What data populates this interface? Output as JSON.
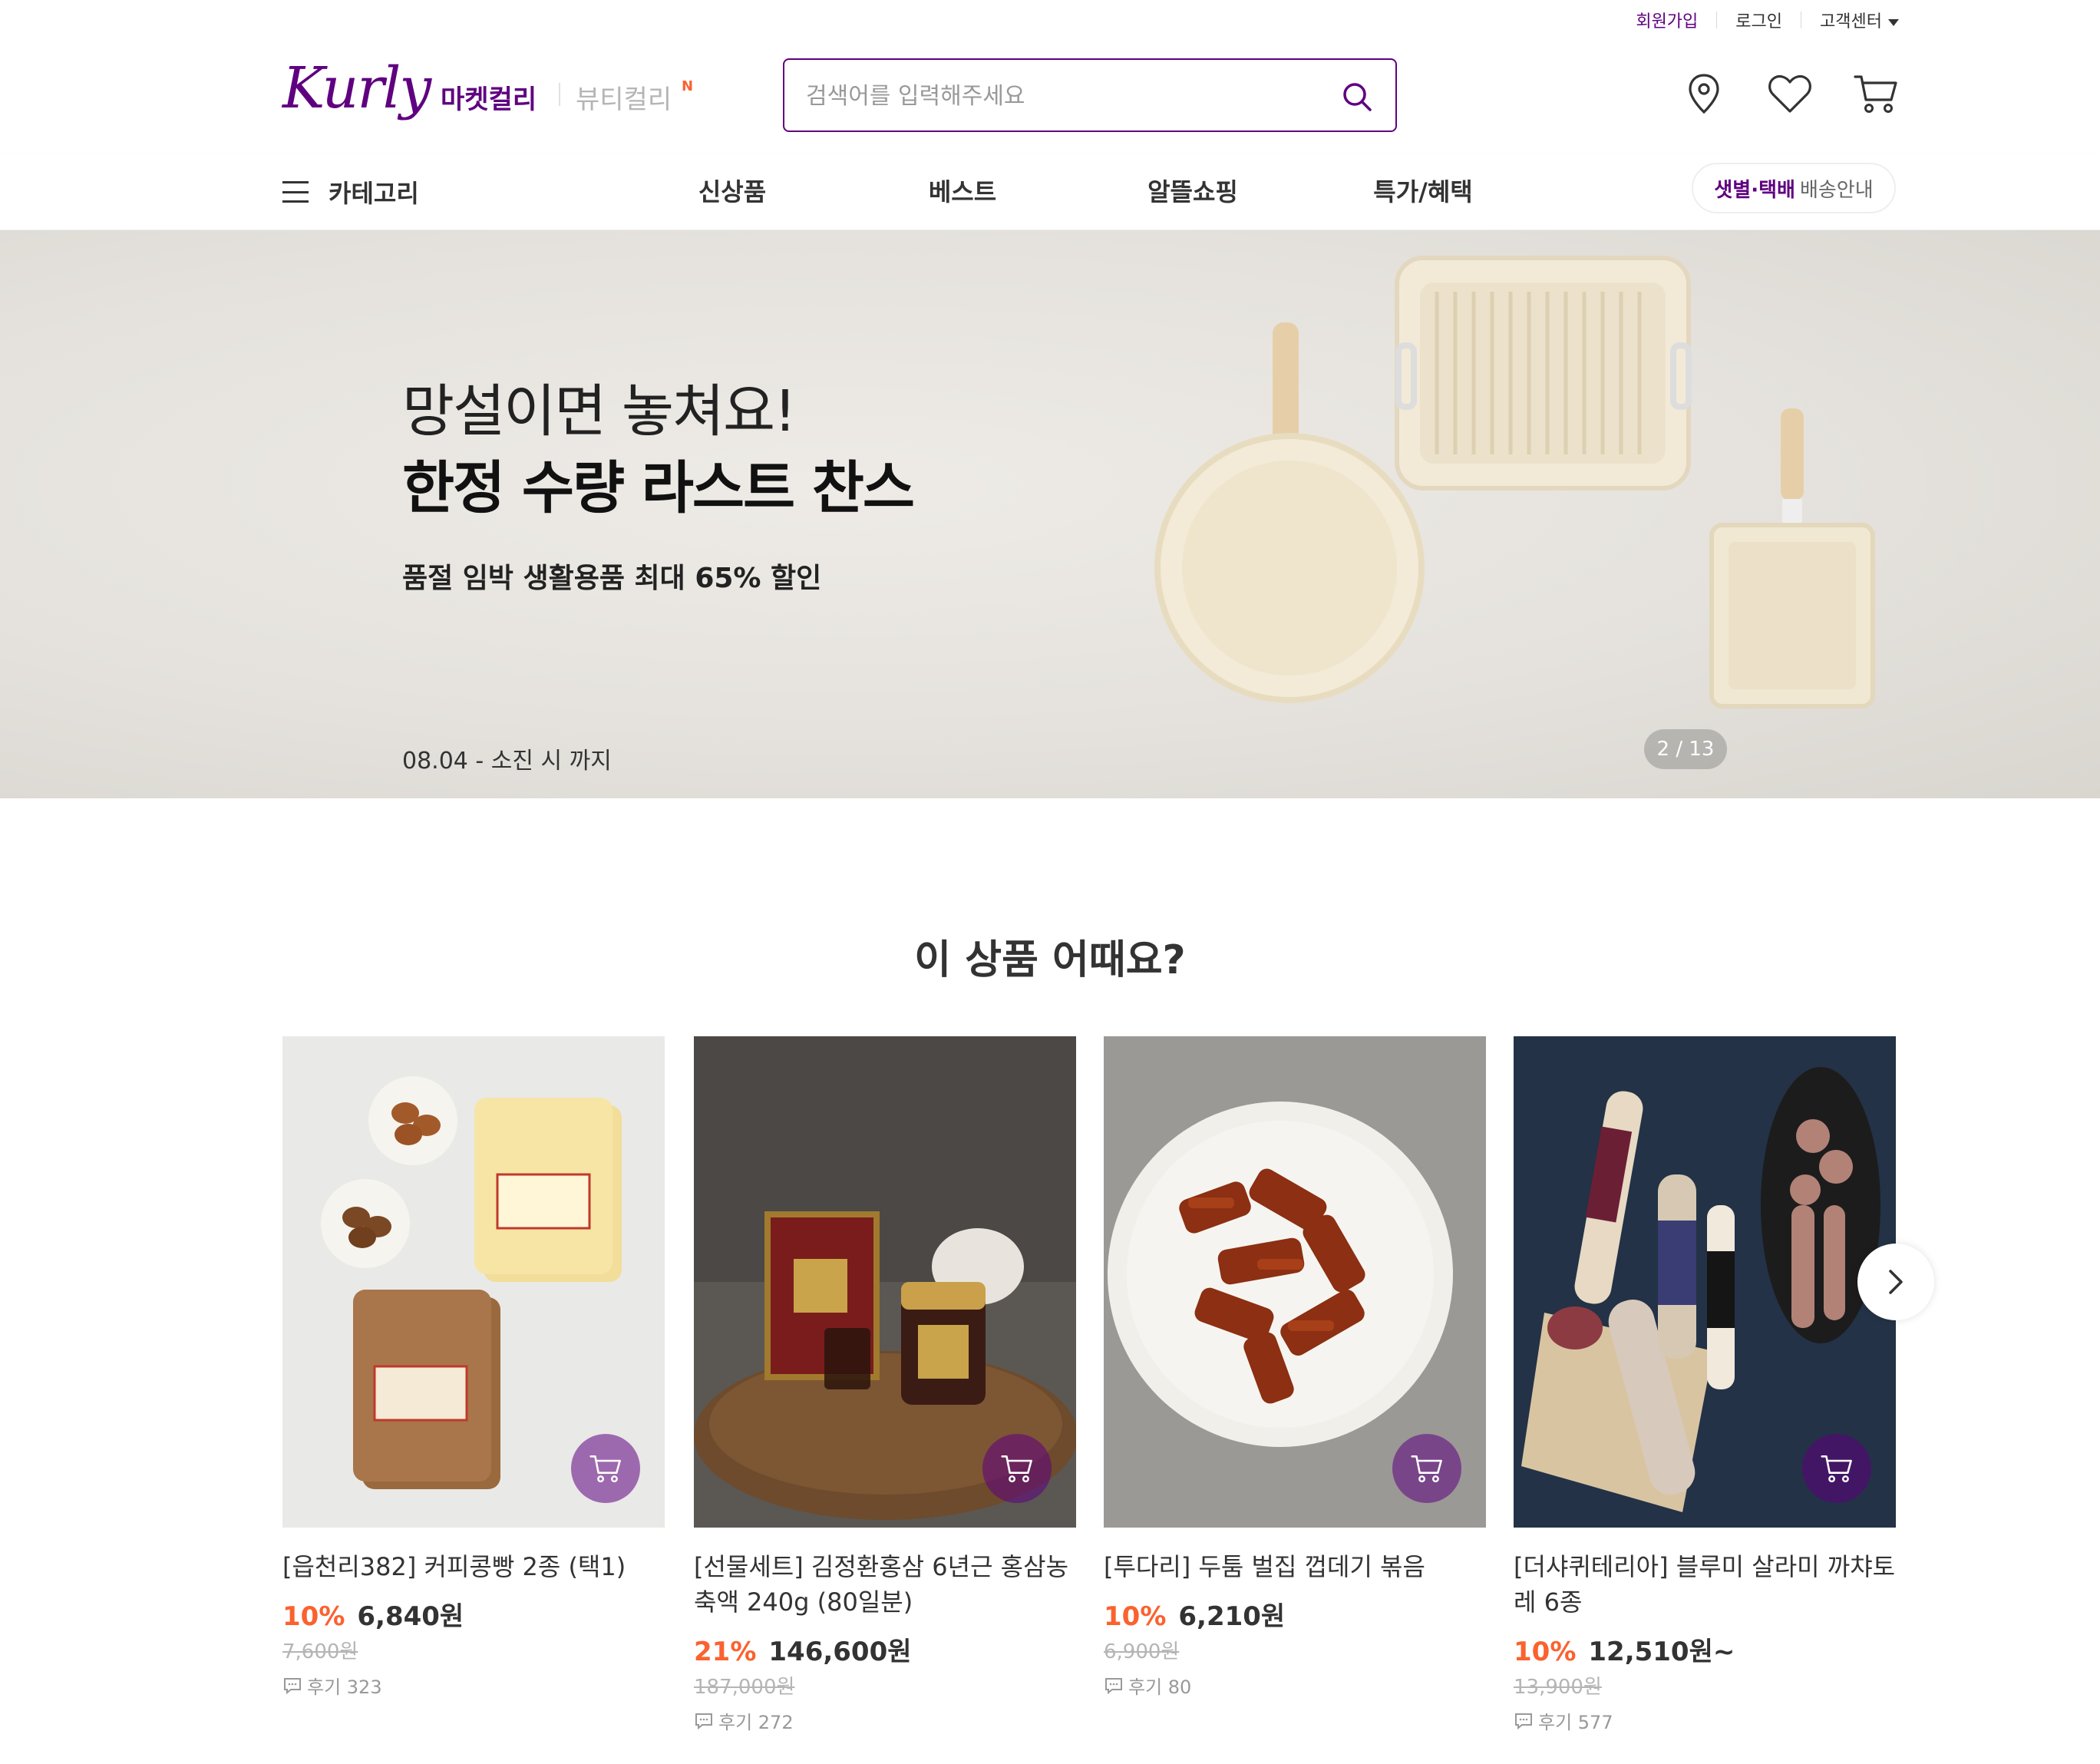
{
  "util": {
    "signup": "회원가입",
    "login": "로그인",
    "customer_center": "고객센터"
  },
  "header": {
    "logo": "Kurly",
    "market_tab": "마켓컬리",
    "beauty_tab": "뷰티컬리",
    "beauty_badge": "N",
    "search_placeholder": "검색어를 입력해주세요",
    "icons": [
      "location-icon",
      "heart-icon",
      "cart-icon"
    ]
  },
  "nav": {
    "category": "카테고리",
    "items": [
      "신상품",
      "베스트",
      "알뜰쇼핑",
      "특가/혜택"
    ],
    "delivery_highlight": "샛별·택배",
    "delivery_rest": "배송안내"
  },
  "banner": {
    "line1": "망설이면 놓쳐요!",
    "line2": "한정 수량 라스트 찬스",
    "sub": "품절 임박 생활용품 최대 65% 할인",
    "date": "08.04 - 소진 시 까지",
    "pager": "2 / 13"
  },
  "section": {
    "title": "이 상품 어때요?"
  },
  "products": [
    {
      "name": "[읍천리382] 커피콩빵 2종 (택1)",
      "discount": "10%",
      "price": "6,840원",
      "original": "7,600원",
      "reviews": "후기 323"
    },
    {
      "name": "[선물세트] 김정환홍삼 6년근 홍삼농축액 240g (80일분)",
      "discount": "21%",
      "price": "146,600원",
      "original": "187,000원",
      "reviews": "후기 272"
    },
    {
      "name": "[투다리] 두툼 벌집 껍데기 볶음",
      "discount": "10%",
      "price": "6,210원",
      "original": "6,900원",
      "reviews": "후기 80"
    },
    {
      "name": "[더샤퀴테리아] 블루미 살라미 까챠토레 6종",
      "discount": "10%",
      "price": "12,510원~",
      "original": "13,900원",
      "reviews": "후기 577"
    }
  ],
  "colors": {
    "brand": "#5f0080",
    "discount": "#fa622f"
  }
}
